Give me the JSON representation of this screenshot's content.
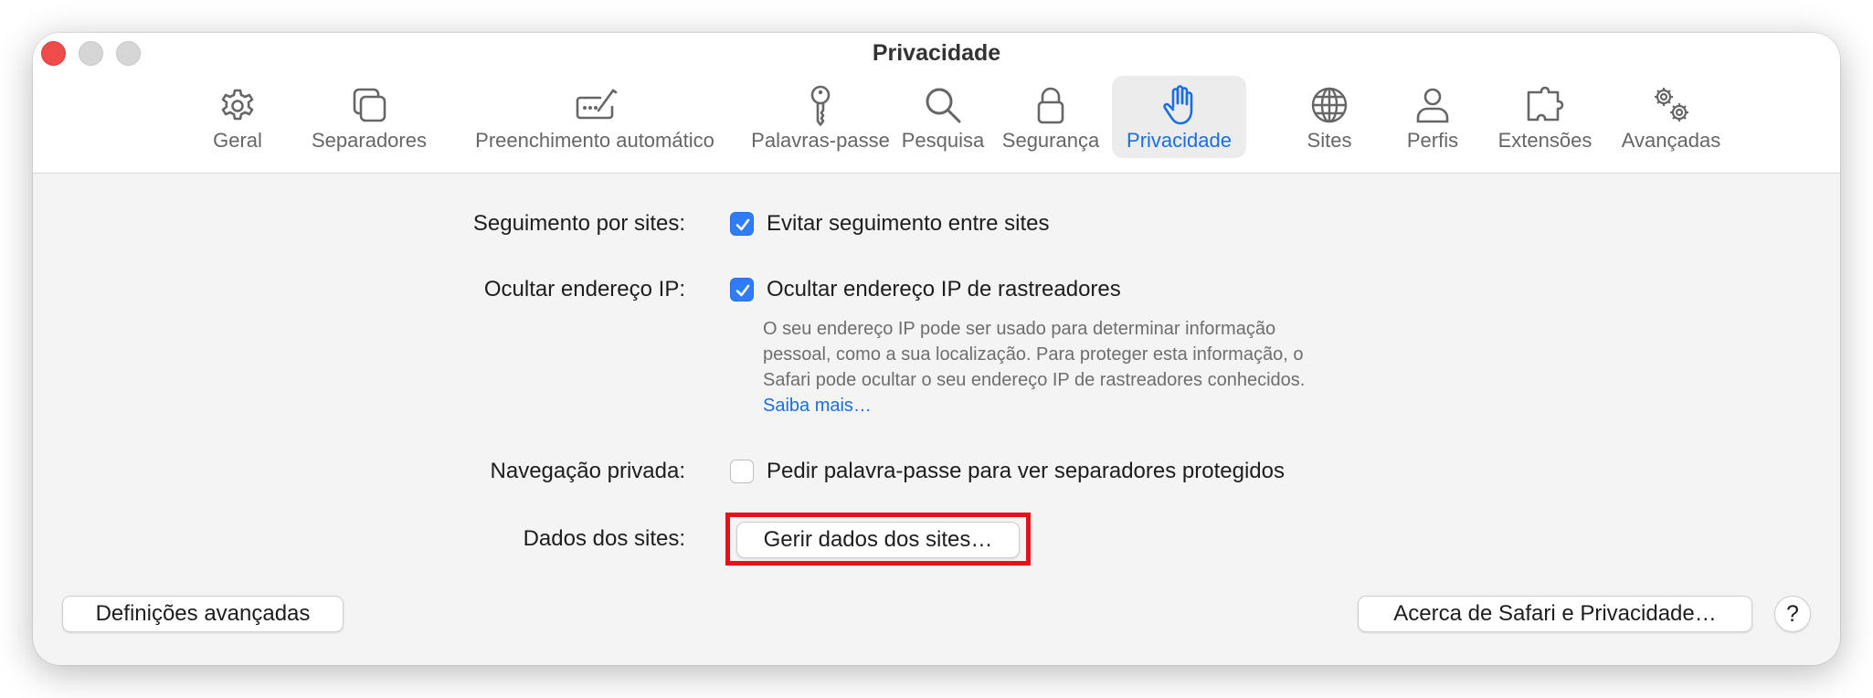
{
  "window": {
    "title": "Privacidade"
  },
  "toolbar": {
    "items": [
      {
        "label": "Geral",
        "icon": "gear-icon"
      },
      {
        "label": "Separadores",
        "icon": "tabs-icon"
      },
      {
        "label": "Preenchimento automático",
        "icon": "autofill-icon"
      },
      {
        "label": "Palavras-passe",
        "icon": "key-icon"
      },
      {
        "label": "Pesquisa",
        "icon": "search-icon"
      },
      {
        "label": "Segurança",
        "icon": "lock-icon"
      },
      {
        "label": "Privacidade",
        "icon": "hand-icon",
        "active": true
      },
      {
        "label": "Sites",
        "icon": "globe-icon"
      },
      {
        "label": "Perfis",
        "icon": "person-icon"
      },
      {
        "label": "Extensões",
        "icon": "puzzle-icon"
      },
      {
        "label": "Avançadas",
        "icon": "gears-icon"
      }
    ]
  },
  "settings": {
    "tracking": {
      "label": "Seguimento por sites:",
      "option": "Evitar seguimento entre sites",
      "checked": true
    },
    "hide_ip": {
      "label": "Ocultar endereço IP:",
      "option": "Ocultar endereço IP de rastreadores",
      "checked": true,
      "description_lines": [
        "O seu endereço IP pode ser usado para determinar informação",
        "pessoal, como a sua localização. Para proteger esta informação, o",
        "Safari pode ocultar o seu endereço IP de rastreadores conhecidos."
      ],
      "learn_more": "Saiba mais…"
    },
    "private_browsing": {
      "label": "Navegação privada:",
      "option": "Pedir palavra-passe para ver separadores protegidos",
      "checked": false
    },
    "website_data": {
      "label": "Dados dos sites:",
      "button": "Gerir dados dos sites…"
    }
  },
  "footer": {
    "advanced_button": "Definições avançadas",
    "about_button": "Acerca de Safari e Privacidade…",
    "help": "?"
  },
  "colors": {
    "accent": "#1a6fe0",
    "checkbox": "#2f7cf6",
    "highlight": "#e8101a",
    "close": "#ee4c4a"
  }
}
